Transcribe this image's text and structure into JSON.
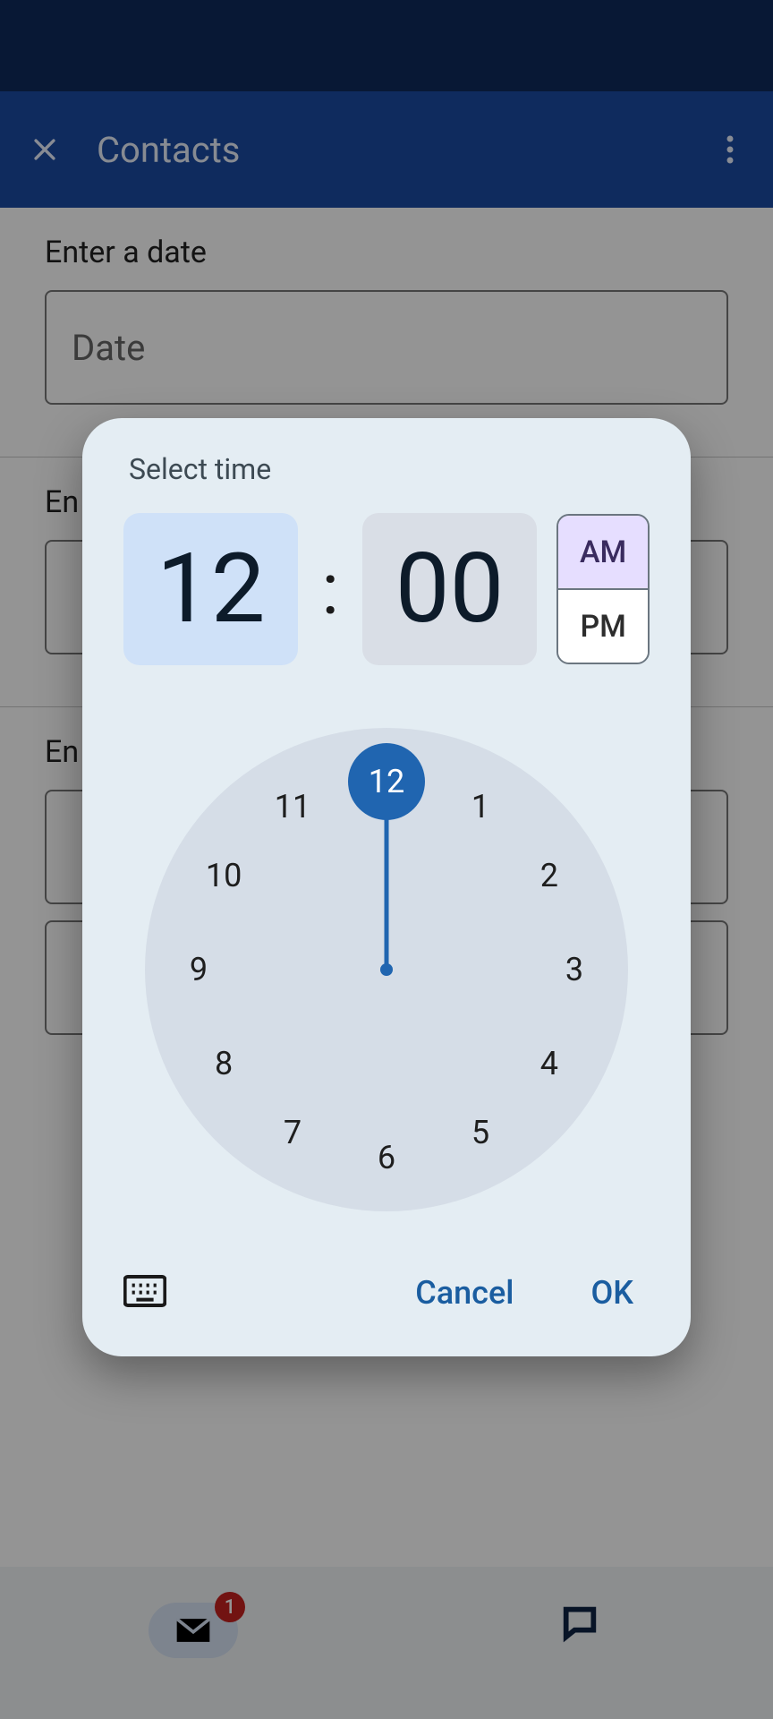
{
  "appbar": {
    "title": "Contacts"
  },
  "form": {
    "date_label": "Enter a date",
    "date_placeholder": "Date",
    "label2_prefix": "En",
    "label3_prefix": "En"
  },
  "bottomnav": {
    "badge_count": "1"
  },
  "dialog": {
    "title": "Select time",
    "hour": "12",
    "minute": "00",
    "am_label": "AM",
    "pm_label": "PM",
    "selected_period": "AM",
    "clock_numbers": [
      "12",
      "1",
      "2",
      "3",
      "4",
      "5",
      "6",
      "7",
      "8",
      "9",
      "10",
      "11"
    ],
    "selected_hour": "12",
    "cancel_label": "Cancel",
    "ok_label": "OK"
  }
}
